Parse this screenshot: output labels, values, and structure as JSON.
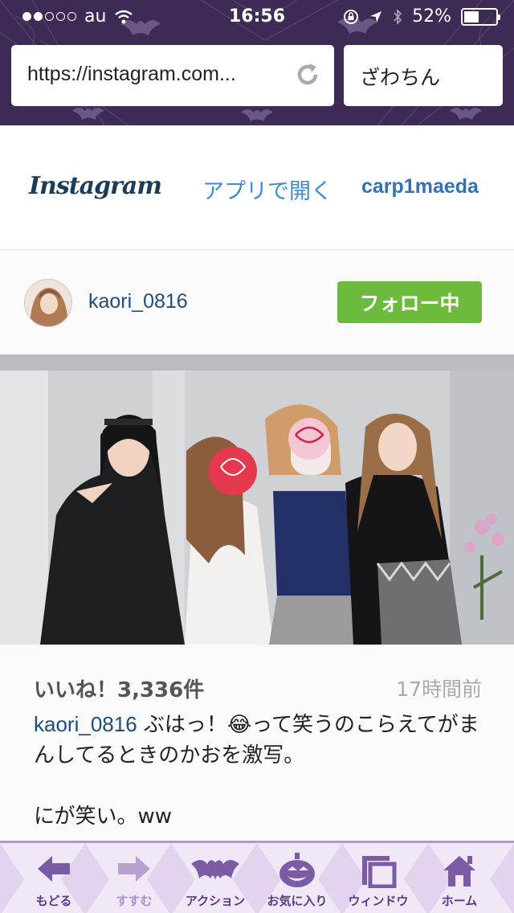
{
  "status_bar": {
    "carrier": "au",
    "time": "16:56",
    "battery": "52%",
    "battery_level": 0.52,
    "signal_dots_filled": 2,
    "signal_dots_total": 5
  },
  "browser": {
    "url": "https://instagram.com...",
    "search_query": "ざわちん",
    "theme_colors": {
      "top": "#3d2b55",
      "toolbar": "#f0e8f7",
      "accent": "#5b3a86"
    }
  },
  "instagram_header": {
    "logo_text": "Instagram",
    "open_in_app": "アプリで開く",
    "username": "carp1maeda"
  },
  "post": {
    "username": "kaori_0816",
    "follow_label": "フォロー中",
    "likes": "いいね！3,336件",
    "time_ago": "17時間前",
    "caption_user": "kaori_0816",
    "caption_text": " ぶはっ！😂って笑うのこらえてがまんしてるときのかおを激写。",
    "caption_line2": "にが笑い。ww"
  },
  "toolbar": {
    "items": [
      {
        "label": "もどる",
        "icon": "back-arrow-icon"
      },
      {
        "label": "すすむ",
        "icon": "forward-arrow-icon"
      },
      {
        "label": "アクション",
        "icon": "bat-icon"
      },
      {
        "label": "お気に入り",
        "icon": "pumpkin-icon"
      },
      {
        "label": "ウィンドウ",
        "icon": "window-icon"
      },
      {
        "label": "ホーム",
        "icon": "home-icon"
      }
    ]
  }
}
